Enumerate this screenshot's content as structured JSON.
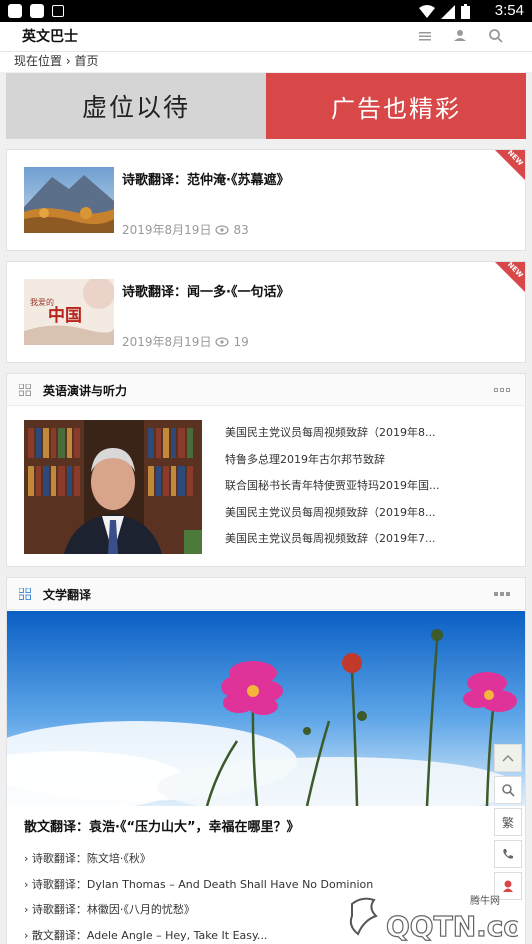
{
  "status": {
    "time": "3:54"
  },
  "app": {
    "title": "英文巴士"
  },
  "breadcrumb": {
    "label": "现在位置",
    "sep": "›",
    "current": "首页"
  },
  "banner": {
    "left": "虚位以待",
    "right": "广告也精彩"
  },
  "articles": [
    {
      "title": "诗歌翻译：范仲淹·《苏幕遮》",
      "date": "2019年8月19日",
      "views": "83",
      "badge": "NEW"
    },
    {
      "title": "诗歌翻译：闻一多·《一句话》",
      "date": "2019年8月19日",
      "views": "19",
      "badge": "NEW",
      "thumb_text": "中国",
      "thumb_small": "我爱的"
    }
  ],
  "speech": {
    "title": "英语演讲与听力",
    "items": [
      "美国民主党议员每周视频致辞（2019年8...",
      "特鲁多总理2019年古尔邦节致辞",
      "联合国秘书长青年特使贾亚特玛2019年国...",
      "美国民主党议员每周视频致辞（2019年8...",
      "美国民主党议员每周视频致辞（2019年7..."
    ]
  },
  "literature": {
    "title": "文学翻译",
    "headline": "散文翻译：袁浩·《“压力山大”，幸福在哪里？》",
    "items": [
      "› 诗歌翻译：陈文培·《秋》",
      "› 诗歌翻译：Dylan Thomas – And Death Shall Have No Dominion",
      "› 诗歌翻译：林徽因·《八月的忧愁》",
      "› 散文翻译：Adele Angle – Hey, Take It Easy..."
    ]
  },
  "float": {
    "trad": "繁"
  },
  "watermark": {
    "site": "腾牛网",
    "logo": "QQTN.com"
  },
  "colors": {
    "accent": "#d94848",
    "icon_blue": "#4a90d9"
  }
}
